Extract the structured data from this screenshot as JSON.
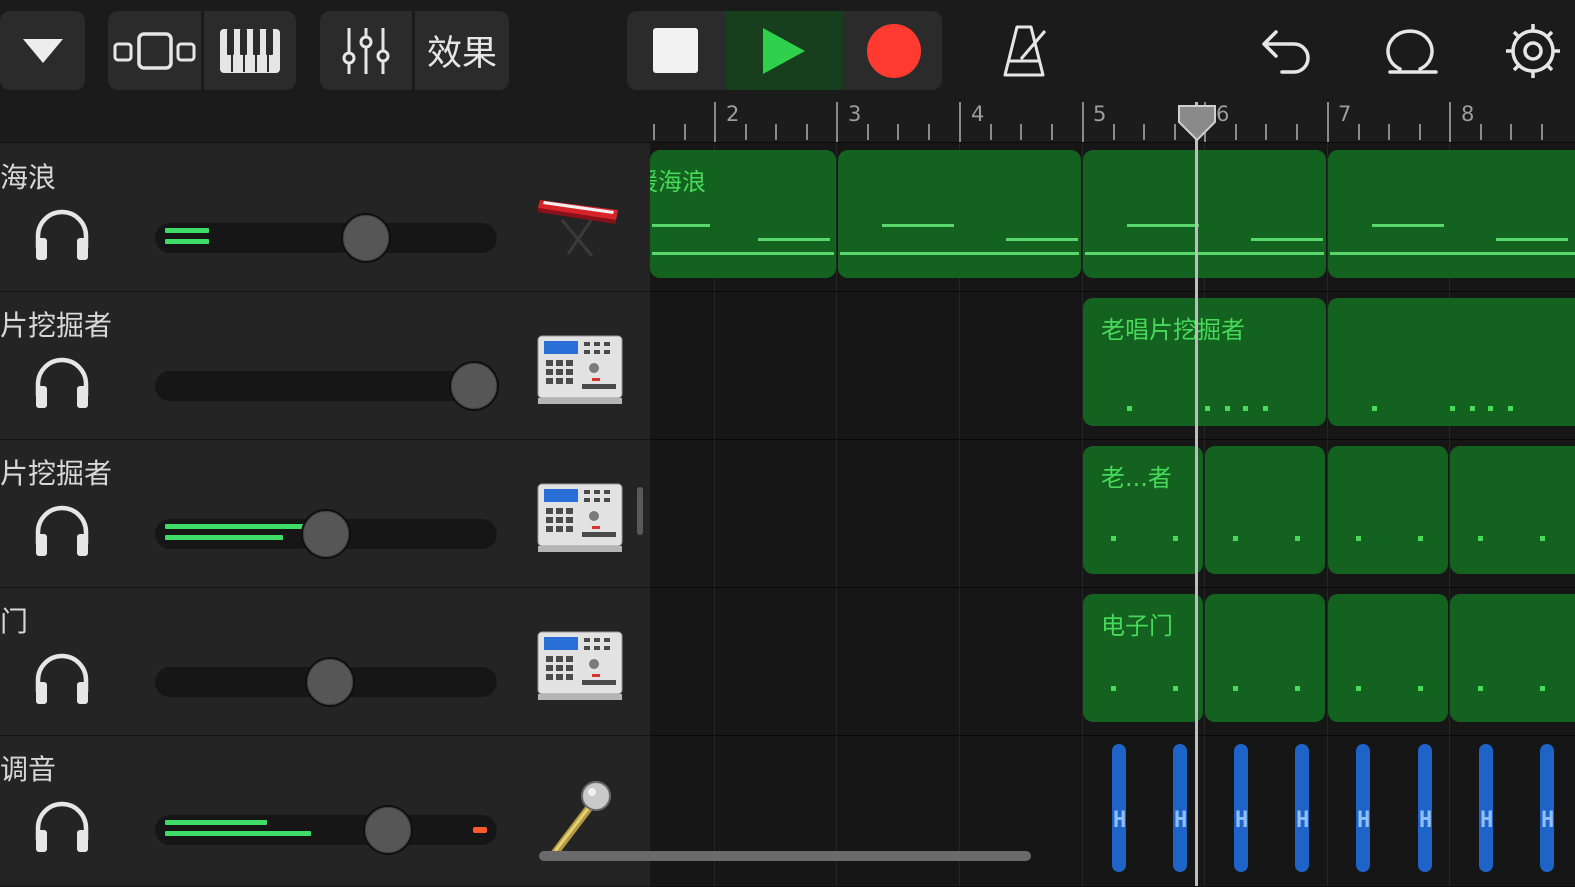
{
  "toolbar": {
    "effects_label": "效果",
    "icons": {
      "browser": "chevron-down-icon",
      "tracks_view": "tracks-view-icon",
      "keyboard": "piano-keyboard-icon",
      "mixer": "mixer-sliders-icon",
      "stop": "stop-icon",
      "play": "play-icon",
      "record": "record-icon",
      "metronome": "metronome-icon",
      "undo": "undo-icon",
      "loop": "loop-icon",
      "settings": "gear-icon"
    },
    "colors": {
      "play": "#2fd04b",
      "record": "#ff3b30",
      "play_bg": "#173f1d"
    }
  },
  "ruler": {
    "bars": [
      "2",
      "3",
      "4",
      "5",
      "6",
      "7",
      "8"
    ]
  },
  "tracks": [
    {
      "name": "海浪",
      "instrument": "keyboard-synth-icon",
      "volume": 0.62,
      "level": 0.13,
      "level2": 0.13
    },
    {
      "name": "片挖掘者",
      "instrument": "drum-machine-icon",
      "volume": 0.93,
      "level": 0,
      "level2": 0
    },
    {
      "name": "片挖掘者",
      "instrument": "drum-machine-icon",
      "volume": 0.5,
      "level": 0.49,
      "level2": 0.36
    },
    {
      "name": "门",
      "instrument": "drum-machine-icon",
      "volume": 0.51,
      "level": 0,
      "level2": 0
    },
    {
      "name": "调音",
      "instrument": "microphone-icon",
      "volume": 0.7,
      "level": 0.31,
      "level2": 0.45
    }
  ],
  "regions": {
    "track1": "暖海浪",
    "track2": "老唱片挖掘者",
    "track3": "老...者",
    "track4": "电子门",
    "track5_hit_letter": "H"
  }
}
